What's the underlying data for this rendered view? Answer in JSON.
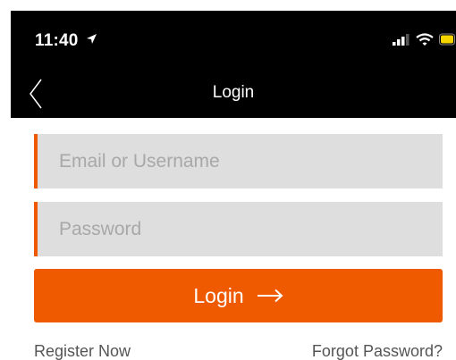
{
  "status_bar": {
    "time": "11:40",
    "icons": [
      "location-arrow-icon",
      "signal-icon",
      "wifi-icon",
      "battery-icon"
    ],
    "battery_color": "#f5d400"
  },
  "nav": {
    "title": "Login",
    "back_icon": "chevron-left-icon"
  },
  "form": {
    "email_placeholder": "Email or Username",
    "email_value": "",
    "password_placeholder": "Password",
    "password_value": "",
    "login_label": "Login",
    "login_icon": "arrow-right-icon"
  },
  "links": {
    "register": "Register Now",
    "forgot": "Forgot Password?"
  },
  "colors": {
    "accent": "#ef5a00",
    "field_bg": "#dedede",
    "bar_bg": "#000000"
  }
}
